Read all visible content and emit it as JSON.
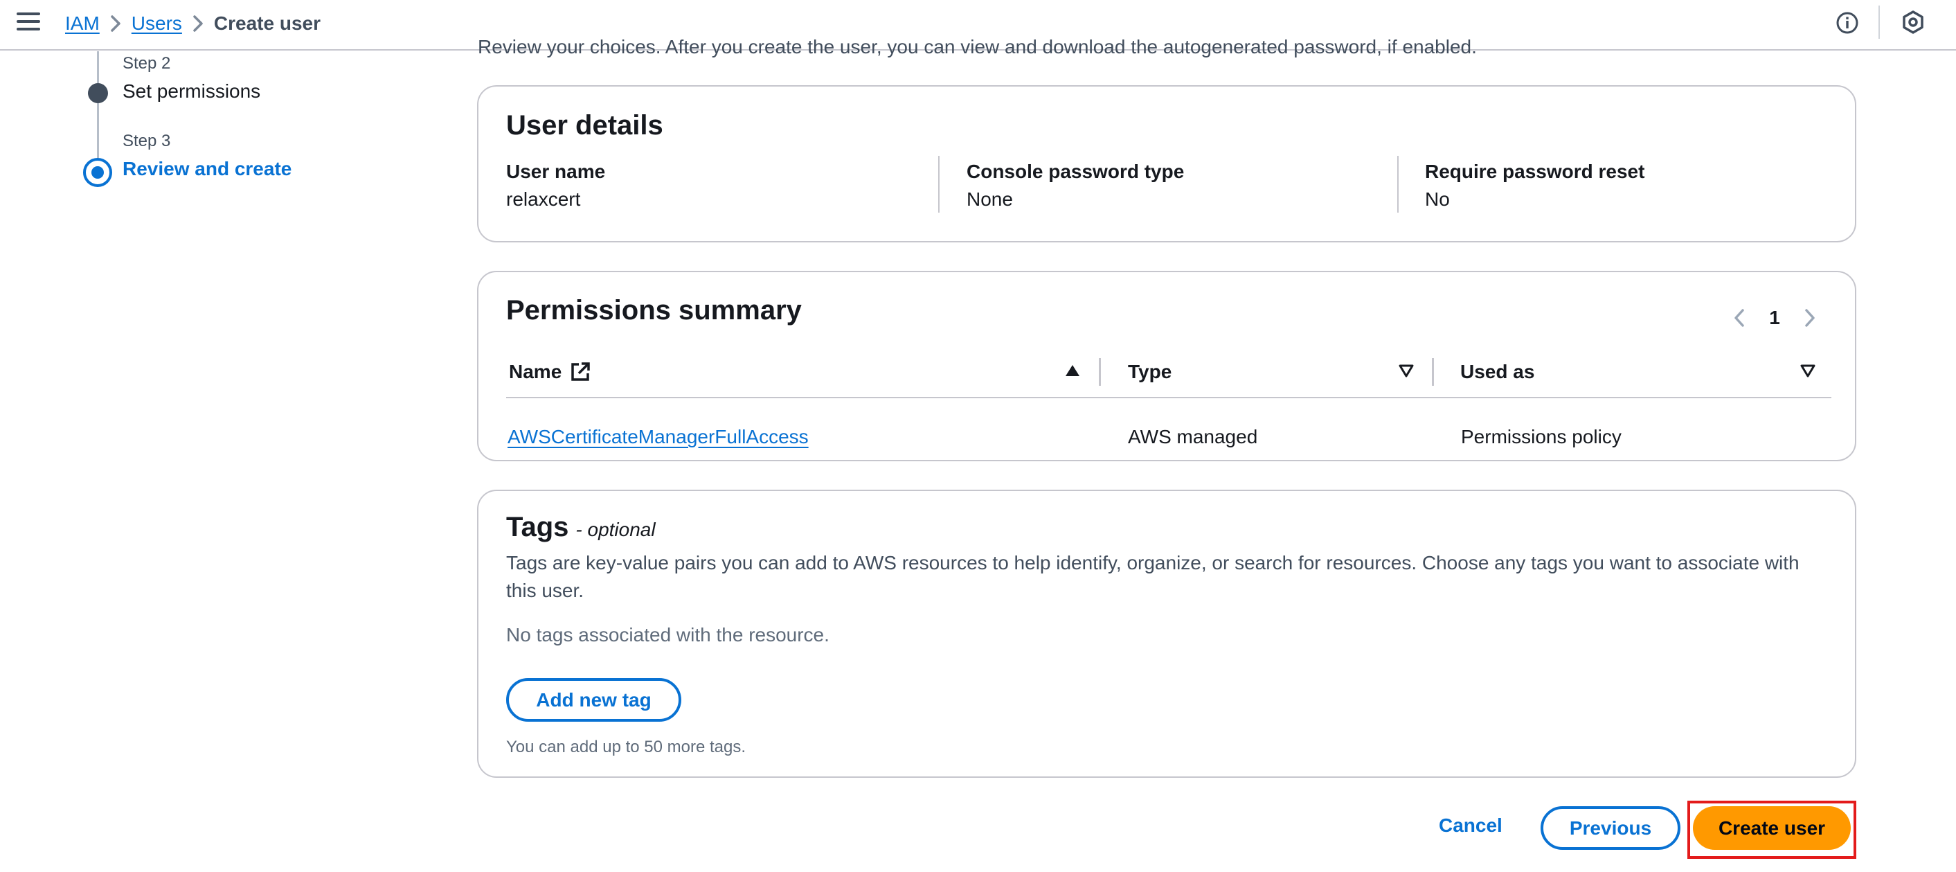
{
  "breadcrumb": {
    "items": [
      "IAM",
      "Users"
    ],
    "current": "Create user"
  },
  "header_icons": {
    "menu": "hamburger-menu-icon",
    "info": "info-icon",
    "settings": "settings-icon"
  },
  "stepper": {
    "steps": [
      {
        "label": "Step 2",
        "title": "Set permissions",
        "state": "completed"
      },
      {
        "label": "Step 3",
        "title": "Review and create",
        "state": "current"
      }
    ]
  },
  "intro_text": "Review your choices. After you create the user, you can view and download the autogenerated password, if enabled.",
  "user_details": {
    "title": "User details",
    "fields": [
      {
        "label": "User name",
        "value": "relaxcert"
      },
      {
        "label": "Console password type",
        "value": "None"
      },
      {
        "label": "Require password reset",
        "value": "No"
      }
    ]
  },
  "permissions": {
    "title": "Permissions summary",
    "page": "1",
    "columns": [
      {
        "label": "Name",
        "sort": "ascending"
      },
      {
        "label": "Type",
        "sort": "none"
      },
      {
        "label": "Used as",
        "sort": "none"
      }
    ],
    "rows": [
      {
        "name": "AWSCertificateManagerFullAccess",
        "type": "AWS managed",
        "used_as": "Permissions policy"
      }
    ]
  },
  "tags": {
    "title": "Tags",
    "optional": "- optional",
    "description": "Tags are key-value pairs you can add to AWS resources to help identify, organize, or search for resources. Choose any tags you want to associate with this user.",
    "empty": "No tags associated with the resource.",
    "add_button": "Add new tag",
    "hint": "You can add up to 50 more tags."
  },
  "actions": {
    "cancel": "Cancel",
    "previous": "Previous",
    "create": "Create user"
  },
  "colors": {
    "link": "#0972d3",
    "primary_button": "#ff9900",
    "highlight_border": "#e31b1b"
  }
}
